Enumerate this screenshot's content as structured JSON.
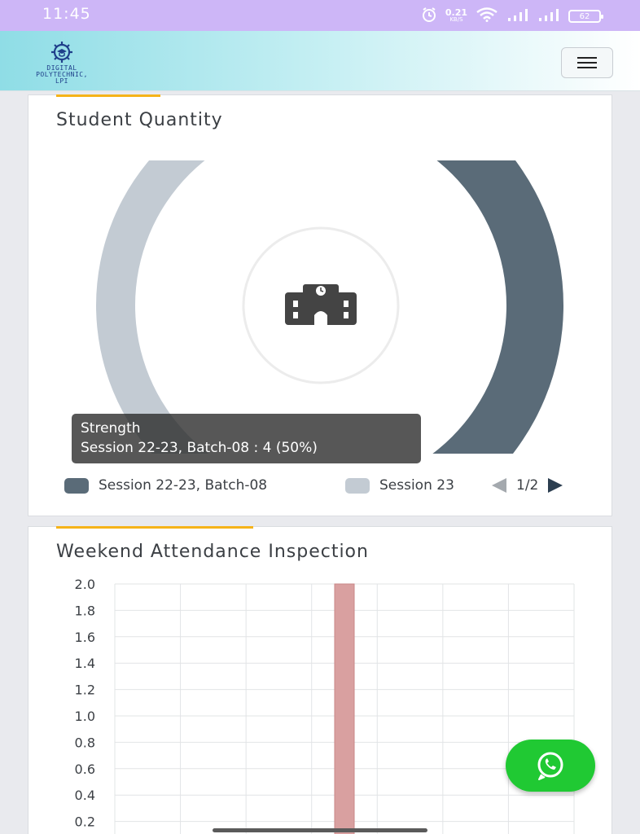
{
  "status_bar": {
    "time": "11:45",
    "net_speed_value": "0.21",
    "net_speed_unit": "KB/S",
    "battery": "62",
    "icons": [
      "alarm-icon",
      "wifi-icon",
      "signal-icon",
      "signal-icon",
      "battery-icon"
    ]
  },
  "app_bar": {
    "logo_line1": "DIGITAL",
    "logo_line2": "POLYTECHNIC,",
    "logo_line3": "LPI",
    "menu_icon": "hamburger-menu-icon"
  },
  "student_quantity": {
    "title": "Student Quantity",
    "center_icon": "school-building-icon",
    "tooltip": {
      "title": "Strength",
      "body": "Session 22-23, Batch-08 : 4 (50%)"
    },
    "legend": {
      "items": [
        {
          "label": "Session 22-23, Batch-08",
          "color": "#5a6b78"
        },
        {
          "label": "Session 23",
          "color": "#c3cbd3"
        }
      ],
      "page": "1/2"
    }
  },
  "weekend_attendance": {
    "title": "Weekend Attendance Inspection"
  },
  "whatsapp_fab": {
    "icon": "whatsapp-icon"
  },
  "chart_data": [
    {
      "type": "pie",
      "title": "Student Quantity",
      "series_name": "Strength",
      "labels": [
        "Session 22-23, Batch-08",
        "Session 23"
      ],
      "values": [
        4,
        4
      ],
      "percentages": [
        50,
        50
      ],
      "colors": [
        "#5a6b78",
        "#c3cbd3"
      ],
      "legend_position": "bottom",
      "hovered_index": 0
    },
    {
      "type": "bar",
      "title": "Weekend Attendance Inspection",
      "categories": [
        "",
        "",
        "",
        "",
        "",
        "",
        ""
      ],
      "values": [
        0,
        0,
        0,
        2,
        0,
        0,
        0
      ],
      "ylim": [
        0,
        2
      ],
      "yticks": [
        "2.0",
        "1.8",
        "1.6",
        "1.4",
        "1.2",
        "1.0",
        "0.8",
        "0.6",
        "0.4",
        "0.2"
      ],
      "bar_color": "#d9a0a0",
      "grid": true
    }
  ]
}
